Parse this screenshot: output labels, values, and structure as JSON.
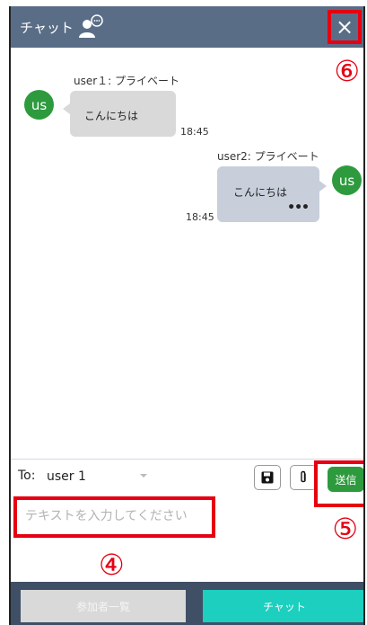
{
  "header": {
    "title": "チャット",
    "chat_icon": "user-chat-bubble-icon",
    "close_label": "×"
  },
  "annotations": {
    "six": "⑥",
    "five": "⑤",
    "four": "④"
  },
  "messages": [
    {
      "avatar": "us",
      "sender": "user１: プライベート",
      "text": "こんにちは",
      "time": "18:45",
      "align": "left"
    },
    {
      "avatar": "us",
      "sender": "user2: プライベート",
      "text": "こんにちは",
      "more": "•••",
      "time": "18:45",
      "align": "right"
    }
  ],
  "composer": {
    "to_label": "To:",
    "to_value": "user 1",
    "placeholder": "テキストを入力してください",
    "save_icon": "save-icon",
    "attach_icon": "paperclip-icon",
    "send_label": "送信"
  },
  "footer": {
    "participants_label": "参加者一覧",
    "chat_label": "チャット"
  },
  "colors": {
    "header_bg": "#5a6d87",
    "accent_green": "#2e9a3e",
    "highlight_red": "#e60012",
    "chat_tab": "#1ccfbf"
  }
}
